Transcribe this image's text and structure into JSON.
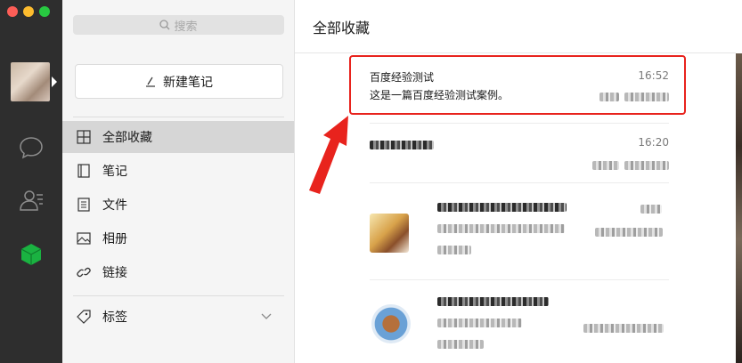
{
  "window": {
    "traffic_colors": [
      "#fd5e57",
      "#fdbc2e",
      "#28c941"
    ]
  },
  "rail": {
    "icons": [
      "avatar",
      "chat-icon",
      "contacts-icon",
      "favorites-cube-icon"
    ],
    "accent": "#1ab241"
  },
  "sidebar": {
    "search_placeholder": "搜索",
    "new_note_label": "新建笔记",
    "items": [
      {
        "label": "全部收藏",
        "icon": "grid-icon",
        "active": true
      },
      {
        "label": "笔记",
        "icon": "notebook-icon"
      },
      {
        "label": "文件",
        "icon": "file-icon"
      },
      {
        "label": "相册",
        "icon": "image-icon"
      },
      {
        "label": "链接",
        "icon": "link-icon"
      }
    ],
    "tags_label": "标签"
  },
  "main": {
    "title": "全部收藏",
    "cards": [
      {
        "title": "百度经验测试",
        "body": "这是一篇百度经验测试案例。",
        "time": "16:52"
      },
      {
        "time": "16:20"
      }
    ]
  },
  "annotation": {
    "highlight_color": "#e8231d"
  }
}
